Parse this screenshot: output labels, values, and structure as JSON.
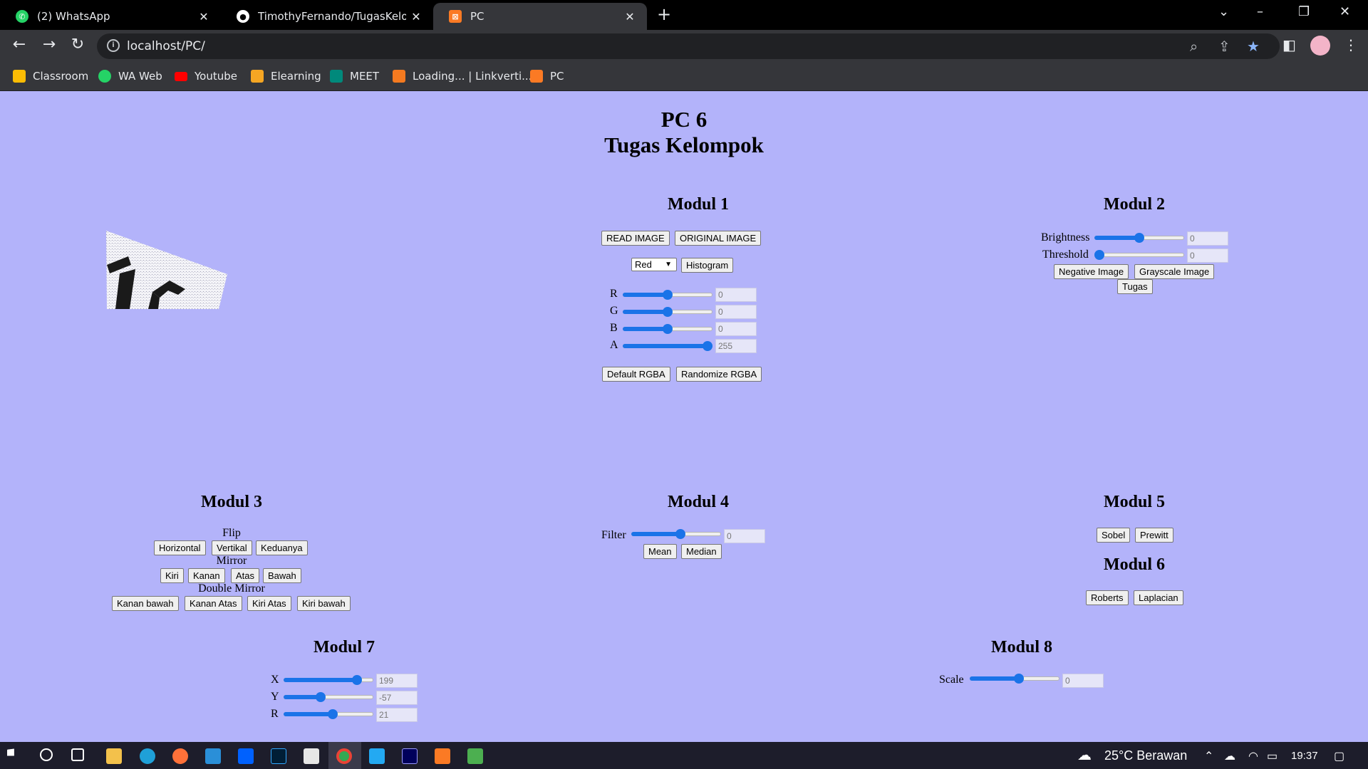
{
  "browser": {
    "tabs": [
      {
        "title": "(2) WhatsApp",
        "icon": "whatsapp-icon"
      },
      {
        "title": "TimothyFernando/TugasKelompo",
        "icon": "github-icon"
      },
      {
        "title": "PC",
        "icon": "xampp-icon"
      }
    ],
    "url": "localhost/PC/",
    "bookmarks": [
      {
        "label": "Classroom",
        "icon": "classroom-icon",
        "color": "#fbbc04"
      },
      {
        "label": "WA Web",
        "icon": "whatsapp-icon",
        "color": "#25d366"
      },
      {
        "label": "Youtube",
        "icon": "youtube-icon",
        "color": "#ff0000"
      },
      {
        "label": "Elearning",
        "icon": "elearning-icon",
        "color": "#f5a623"
      },
      {
        "label": "MEET",
        "icon": "meet-icon",
        "color": "#00897b"
      },
      {
        "label": "Loading... | Linkverti...",
        "icon": "linkvertise-icon",
        "color": "#f47a20"
      },
      {
        "label": "PC",
        "icon": "xampp-icon",
        "color": "#fb7a24"
      }
    ]
  },
  "page": {
    "title_line1": "PC 6",
    "title_line2": "Tugas Kelompok",
    "modul1": {
      "heading": "Modul 1",
      "read_image": "READ IMAGE",
      "original_image": "ORIGINAL IMAGE",
      "channel_select": "Red",
      "histogram": "Histogram",
      "sliders": [
        {
          "label": "R",
          "value": "0",
          "level": 0.5
        },
        {
          "label": "G",
          "value": "0",
          "level": 0.5
        },
        {
          "label": "B",
          "value": "0",
          "level": 0.5
        },
        {
          "label": "A",
          "value": "255",
          "level": 1.0
        }
      ],
      "default_rgba": "Default RGBA",
      "randomize_rgba": "Randomize RGBA"
    },
    "modul2": {
      "heading": "Modul 2",
      "brightness_label": "Brightness",
      "brightness_value": "0",
      "brightness_level": 0.5,
      "threshold_label": "Threshold",
      "threshold_value": "0",
      "threshold_level": 0.0,
      "negative": "Negative Image",
      "grayscale": "Grayscale Image",
      "tugas": "Tugas"
    },
    "modul3": {
      "heading": "Modul 3",
      "flip_label": "Flip",
      "flip": [
        "Horizontal",
        "Vertikal",
        "Keduanya"
      ],
      "mirror_label": "Mirror",
      "mirror": [
        "Kiri",
        "Kanan",
        "Atas",
        "Bawah"
      ],
      "double_mirror_label": "Double Mirror",
      "double_mirror": [
        "Kanan bawah",
        "Kanan Atas",
        "Kiri Atas",
        "Kiri bawah"
      ]
    },
    "modul4": {
      "heading": "Modul 4",
      "filter_label": "Filter",
      "filter_value": "0",
      "filter_level": 0.55,
      "mean": "Mean",
      "median": "Median"
    },
    "modul5": {
      "heading": "Modul 5",
      "sobel": "Sobel",
      "prewitt": "Prewitt"
    },
    "modul6": {
      "heading": "Modul 6",
      "roberts": "Roberts",
      "laplacian": "Laplacian"
    },
    "modul7": {
      "heading": "Modul 7",
      "sliders": [
        {
          "label": "X",
          "value": "199",
          "level": 0.86
        },
        {
          "label": "Y",
          "value": "-57",
          "level": 0.4
        },
        {
          "label": "R",
          "value": "21",
          "level": 0.55
        }
      ]
    },
    "modul8": {
      "heading": "Modul 8",
      "scale_label": "Scale",
      "scale_value": "0",
      "scale_level": 0.55
    }
  },
  "taskbar": {
    "weather": "25°C Berawan",
    "time": "19:37"
  }
}
